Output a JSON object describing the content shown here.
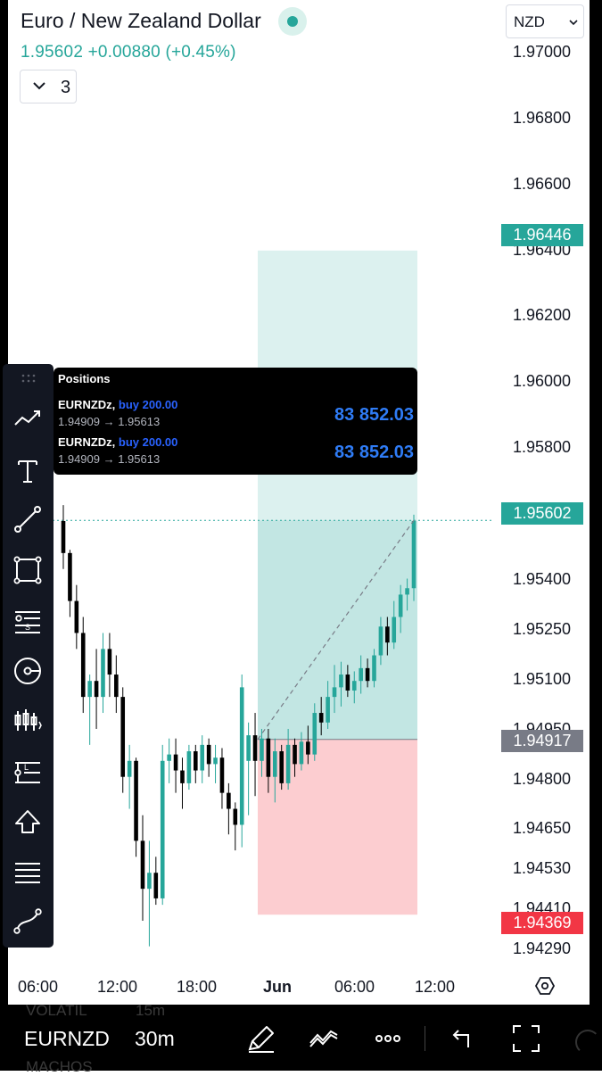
{
  "header": {
    "title": "Euro / New Zealand Dollar",
    "last_price": "1.95602",
    "change": "+0.00880",
    "change_pct": "(+0.45%)",
    "indicators_toggle_count": "3",
    "currency": "NZD"
  },
  "colors": {
    "up": "#26a69a",
    "down": "#000000",
    "target_zone": "#26a69a",
    "stop_zone": "#f23645",
    "stop_tag": "#f23645",
    "entry_tag": "#787b86",
    "positions_pnl": "#2f7cf6"
  },
  "price_axis": {
    "ticks": [
      "1.97000",
      "1.96800",
      "1.96600",
      "1.96400",
      "1.96200",
      "1.96000",
      "1.95800",
      "1.95400",
      "1.95250",
      "1.95100",
      "1.94950",
      "1.94800",
      "1.94650",
      "1.94530",
      "1.94410",
      "1.94290"
    ]
  },
  "price_tags": {
    "target": "1.96446",
    "current": "1.95602",
    "entry": "1.94917",
    "stop": "1.94369"
  },
  "time_axis": {
    "ticks": [
      "06:00",
      "12:00",
      "18:00",
      "Jun",
      "06:00",
      "12:00"
    ]
  },
  "positions_panel": {
    "title": "Positions",
    "rows": [
      {
        "symbol": "EURNZDz,",
        "side": "buy 200.00",
        "prices": "1.94909 → 1.95613",
        "pnl": "83 852.03"
      },
      {
        "symbol": "EURNZDz,",
        "side": "buy 200.00",
        "prices": "1.94909 → 1.95613",
        "pnl": "83 852.03"
      }
    ]
  },
  "toolbar": {
    "tools": [
      "trend-line-icon",
      "text-icon",
      "line-icon",
      "rectangle-icon",
      "fib-retracement-icon",
      "circle-target-icon",
      "candles-pattern-icon",
      "long-position-icon",
      "arrow-up-icon",
      "horizontal-lines-icon",
      "curve-icon"
    ]
  },
  "bottom_bar": {
    "symbol": "EURNZD",
    "interval": "30m",
    "ghost_label_1": "VOLATIL",
    "ghost_label_2": "15m",
    "ghost_label_3": "MACHOS"
  },
  "chart_data": {
    "type": "candlestick",
    "ylim": [
      1.9423,
      1.9709
    ],
    "candles": [
      {
        "o": 1.956,
        "h": 1.9565,
        "l": 1.9545,
        "c": 1.955
      },
      {
        "o": 1.955,
        "h": 1.9551,
        "l": 1.953,
        "c": 1.9535
      },
      {
        "o": 1.9535,
        "h": 1.954,
        "l": 1.952,
        "c": 1.9525
      },
      {
        "o": 1.9525,
        "h": 1.953,
        "l": 1.95,
        "c": 1.9505
      },
      {
        "o": 1.9505,
        "h": 1.9512,
        "l": 1.949,
        "c": 1.951
      },
      {
        "o": 1.951,
        "h": 1.952,
        "l": 1.9495,
        "c": 1.9505
      },
      {
        "o": 1.9505,
        "h": 1.9525,
        "l": 1.95,
        "c": 1.952
      },
      {
        "o": 1.952,
        "h": 1.9525,
        "l": 1.9505,
        "c": 1.9512
      },
      {
        "o": 1.9512,
        "h": 1.9518,
        "l": 1.95,
        "c": 1.9505
      },
      {
        "o": 1.9505,
        "h": 1.9508,
        "l": 1.9475,
        "c": 1.948
      },
      {
        "o": 1.948,
        "h": 1.949,
        "l": 1.947,
        "c": 1.9485
      },
      {
        "o": 1.9485,
        "h": 1.9486,
        "l": 1.9455,
        "c": 1.946
      },
      {
        "o": 1.946,
        "h": 1.9468,
        "l": 1.9435,
        "c": 1.9445
      },
      {
        "o": 1.9445,
        "h": 1.946,
        "l": 1.9427,
        "c": 1.945
      },
      {
        "o": 1.945,
        "h": 1.9455,
        "l": 1.944,
        "c": 1.9442
      },
      {
        "o": 1.9442,
        "h": 1.949,
        "l": 1.944,
        "c": 1.9485
      },
      {
        "o": 1.9485,
        "h": 1.9492,
        "l": 1.9478,
        "c": 1.9487
      },
      {
        "o": 1.9487,
        "h": 1.9492,
        "l": 1.9475,
        "c": 1.9482
      },
      {
        "o": 1.9482,
        "h": 1.9486,
        "l": 1.947,
        "c": 1.9478
      },
      {
        "o": 1.9478,
        "h": 1.949,
        "l": 1.9476,
        "c": 1.9488
      },
      {
        "o": 1.9488,
        "h": 1.949,
        "l": 1.9478,
        "c": 1.9482
      },
      {
        "o": 1.9482,
        "h": 1.9493,
        "l": 1.9478,
        "c": 1.949
      },
      {
        "o": 1.949,
        "h": 1.9492,
        "l": 1.948,
        "c": 1.9484
      },
      {
        "o": 1.9484,
        "h": 1.949,
        "l": 1.9478,
        "c": 1.9486
      },
      {
        "o": 1.9486,
        "h": 1.9489,
        "l": 1.947,
        "c": 1.9475
      },
      {
        "o": 1.9475,
        "h": 1.9478,
        "l": 1.9462,
        "c": 1.947
      },
      {
        "o": 1.947,
        "h": 1.9472,
        "l": 1.9457,
        "c": 1.9465
      },
      {
        "o": 1.9465,
        "h": 1.9512,
        "l": 1.9458,
        "c": 1.9508
      },
      {
        "o": 1.9485,
        "h": 1.9497,
        "l": 1.9468,
        "c": 1.9493
      },
      {
        "o": 1.9493,
        "h": 1.95,
        "l": 1.9474,
        "c": 1.9485
      },
      {
        "o": 1.9485,
        "h": 1.9495,
        "l": 1.948,
        "c": 1.9492
      },
      {
        "o": 1.9492,
        "h": 1.9495,
        "l": 1.9475,
        "c": 1.948
      },
      {
        "o": 1.948,
        "h": 1.9492,
        "l": 1.9472,
        "c": 1.9488
      },
      {
        "o": 1.9488,
        "h": 1.949,
        "l": 1.9476,
        "c": 1.9478
      },
      {
        "o": 1.9478,
        "h": 1.9495,
        "l": 1.9476,
        "c": 1.949
      },
      {
        "o": 1.949,
        "h": 1.9492,
        "l": 1.948,
        "c": 1.9484
      },
      {
        "o": 1.9484,
        "h": 1.9494,
        "l": 1.9482,
        "c": 1.9491
      },
      {
        "o": 1.9491,
        "h": 1.9496,
        "l": 1.9484,
        "c": 1.9487
      },
      {
        "o": 1.9487,
        "h": 1.9503,
        "l": 1.9485,
        "c": 1.95
      },
      {
        "o": 1.95,
        "h": 1.9505,
        "l": 1.9493,
        "c": 1.9497
      },
      {
        "o": 1.9497,
        "h": 1.951,
        "l": 1.9495,
        "c": 1.9505
      },
      {
        "o": 1.9505,
        "h": 1.9515,
        "l": 1.95,
        "c": 1.9508
      },
      {
        "o": 1.9508,
        "h": 1.9516,
        "l": 1.9502,
        "c": 1.9512
      },
      {
        "o": 1.9512,
        "h": 1.9515,
        "l": 1.9505,
        "c": 1.9507
      },
      {
        "o": 1.9507,
        "h": 1.9513,
        "l": 1.9503,
        "c": 1.951
      },
      {
        "o": 1.951,
        "h": 1.9518,
        "l": 1.9506,
        "c": 1.9514
      },
      {
        "o": 1.9514,
        "h": 1.9517,
        "l": 1.9508,
        "c": 1.951
      },
      {
        "o": 1.951,
        "h": 1.952,
        "l": 1.9508,
        "c": 1.9518
      },
      {
        "o": 1.9518,
        "h": 1.953,
        "l": 1.9515,
        "c": 1.9527
      },
      {
        "o": 1.9527,
        "h": 1.953,
        "l": 1.9518,
        "c": 1.9522
      },
      {
        "o": 1.9522,
        "h": 1.9535,
        "l": 1.952,
        "c": 1.953
      },
      {
        "o": 1.953,
        "h": 1.954,
        "l": 1.9525,
        "c": 1.9537
      },
      {
        "o": 1.9537,
        "h": 1.9542,
        "l": 1.9532,
        "c": 1.9539
      },
      {
        "o": 1.9539,
        "h": 1.9562,
        "l": 1.9535,
        "c": 1.956
      }
    ]
  }
}
